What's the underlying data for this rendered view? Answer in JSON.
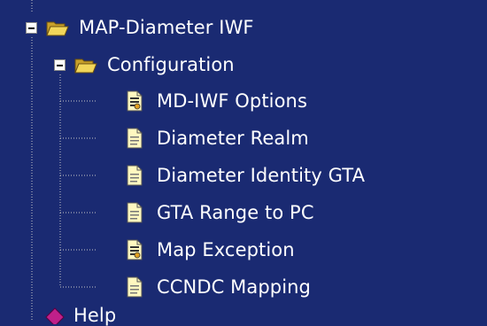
{
  "tree": {
    "root": {
      "label": "MAP-Diameter IWF",
      "icon": "open-folder-icon",
      "expanded": true
    },
    "configuration": {
      "label": "Configuration",
      "icon": "open-folder-icon",
      "expanded": true
    },
    "items": [
      {
        "label": "MD-IWF Options",
        "icon": "config-document-icon"
      },
      {
        "label": "Diameter Realm",
        "icon": "document-icon"
      },
      {
        "label": "Diameter Identity GTA",
        "icon": "document-icon"
      },
      {
        "label": "GTA Range to PC",
        "icon": "document-icon"
      },
      {
        "label": "Map Exception",
        "icon": "config-document-icon"
      },
      {
        "label": "CCNDC Mapping",
        "icon": "document-icon"
      }
    ],
    "next_node": {
      "label": "Help",
      "icon": "help-icon"
    }
  },
  "colors": {
    "background": "#1a2a72",
    "text": "#ffffff",
    "folder": "#e8c84a",
    "document": "#fff8c0"
  }
}
